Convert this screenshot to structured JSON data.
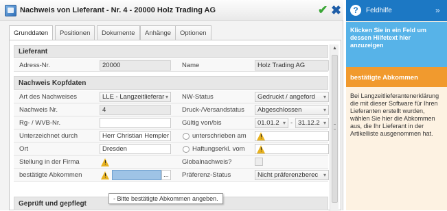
{
  "window": {
    "title": "Nachweis von Lieferant - Nr. 4 - 20000 Holz Trading AG",
    "ok_icon": "checkmark-icon",
    "close_icon": "close-x-icon"
  },
  "tabs": [
    "Grunddaten",
    "Positionen",
    "Dokumente",
    "Anhänge",
    "Optionen"
  ],
  "active_tab": "Grunddaten",
  "sections": {
    "lieferant": "Lieferant",
    "kopfdaten": "Nachweis Kopfdaten",
    "geprueft": "Geprüft und gepflegt"
  },
  "fields": {
    "adress_nr": {
      "label": "Adress-Nr.",
      "value": "20000"
    },
    "name": {
      "label": "Name",
      "value": "Holz Trading AG"
    },
    "art": {
      "label": "Art des Nachweises",
      "value": "LLE - Langzeitlieferar"
    },
    "nw_status": {
      "label": "NW-Status",
      "value": "Gedruckt / angeford"
    },
    "nachweis_nr": {
      "label": "Nachweis Nr.",
      "value": "4"
    },
    "druck_status": {
      "label": "Druck-/Versandstatus",
      "value": "Abgeschlossen"
    },
    "rg_wvb": {
      "label": "Rg- / WVB-Nr.",
      "value": ""
    },
    "gueltig": {
      "label": "Gültig von/bis",
      "from": "01.01.2",
      "sep": "-",
      "to": "31.12.2"
    },
    "unterzeichnet": {
      "label": "Unterzeichnet durch",
      "value": "Herr Christian Hempler"
    },
    "unterschrieben": {
      "label": "unterschrieben am"
    },
    "ort": {
      "label": "Ort",
      "value": "Dresden"
    },
    "haftung": {
      "label": "Haftungserkl. vom"
    },
    "stellung": {
      "label": "Stellung in der Firma"
    },
    "global": {
      "label": "Globalnachweis?"
    },
    "abkommen": {
      "label": "bestätigte Abkommen",
      "button": "..."
    },
    "praeferenz": {
      "label": "Präferenz-Status",
      "value": "Nicht präferenzberec"
    }
  },
  "tooltip": "- Bitte bestätigte Abkommen angeben.",
  "help": {
    "title": "Feldhilfe",
    "collapse": "»",
    "intro": "Klicken Sie in ein Feld um dessen Hilfetext hier anzuzeigen",
    "topic": "bestätigte Abkommen",
    "body": "Bei Langzeitlieferantenerklärung die mit dieser Software für Ihren Lieferanten erstellt wurden, wählen Sie hier die Abkommen aus, die Ihr Lieferant in der Artikelliste ausgenommen hat."
  }
}
